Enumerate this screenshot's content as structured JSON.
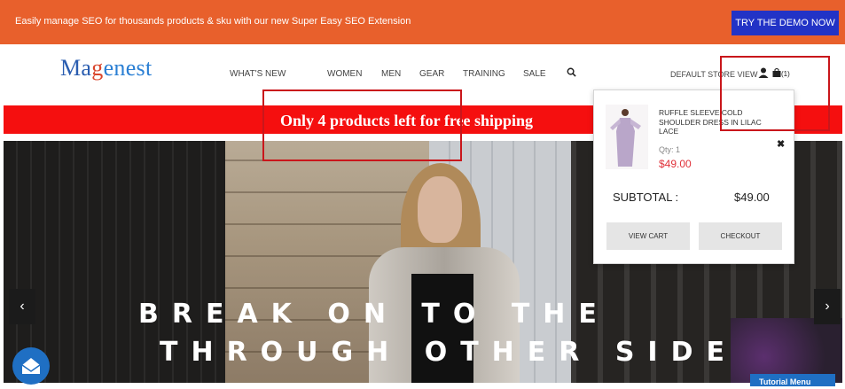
{
  "promo": {
    "message": "Easily manage SEO for thousands products & sku with our new Super Easy SEO Extension",
    "demo_button": "TRY THE DEMO NOW"
  },
  "logo": {
    "part1": "Ma",
    "part2": "g",
    "part3": "enest"
  },
  "nav": {
    "items": [
      "WHAT'S NEW",
      "WOMEN",
      "MEN",
      "GEAR",
      "TRAINING",
      "SALE"
    ],
    "search_icon": "search-icon"
  },
  "header": {
    "store_view": "DEFAULT STORE VIEW",
    "user_icon": "user-icon",
    "cart_icon": "shopping-bag-icon",
    "cart_count": "(1)"
  },
  "shipping_banner": {
    "text": "Only 4 products left for free shipping"
  },
  "hero": {
    "line1": "BREAK ON        TO THE",
    "line2": "THROUGH        OTHER SIDE",
    "prev_label": "‹",
    "next_label": "›"
  },
  "minicart": {
    "product_name": "RUFFLE SLEEVE COLD SHOULDER DRESS IN LILAC LACE",
    "qty": "Qty: 1",
    "price": "$49.00",
    "remove_label": "✖",
    "subtotal_label": "SUBTOTAL :",
    "subtotal_value": "$49.00",
    "view_cart": "VIEW CART",
    "checkout": "CHECKOUT"
  },
  "tutorial": {
    "label": "Tutorial Menu"
  },
  "colors": {
    "promo_bg": "#e8602c",
    "demo_button": "#2233c6",
    "shipping_bar": "#f50f0f",
    "price": "#e0323a",
    "highlight_box": "#c9161b"
  }
}
